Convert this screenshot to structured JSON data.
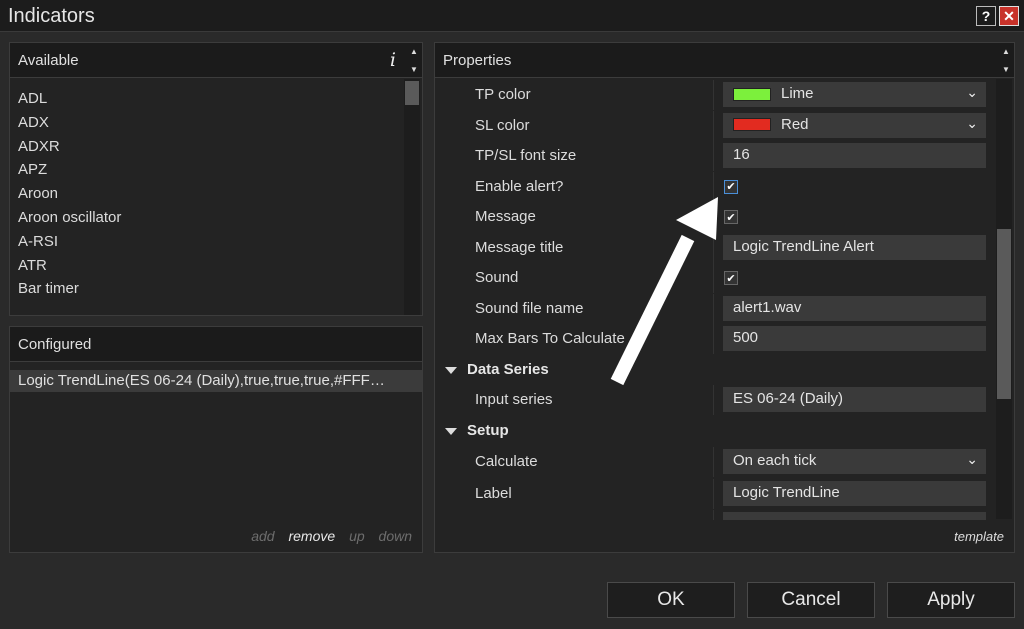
{
  "window": {
    "title": "Indicators",
    "help_label": "?",
    "close_label": "✕"
  },
  "available": {
    "header": "Available",
    "info_label": "i",
    "items": [
      "ADL",
      "ADX",
      "ADXR",
      "APZ",
      "Aroon",
      "Aroon oscillator",
      "A-RSI",
      "ATR",
      "Bar timer"
    ]
  },
  "configured": {
    "header": "Configured",
    "items": [
      "Logic TrendLine(ES 06-24 (Daily),true,true,true,#FFF…"
    ],
    "actions": {
      "add": "add",
      "remove": "remove",
      "up": "up",
      "down": "down"
    }
  },
  "properties": {
    "header": "Properties",
    "rows": {
      "tp_color": {
        "label": "TP color",
        "value": "Lime",
        "swatch": "#7cf03c"
      },
      "sl_color": {
        "label": "SL color",
        "value": "Red",
        "swatch": "#e22b20"
      },
      "font_size": {
        "label": "TP/SL font size",
        "value": "16"
      },
      "enable_alert": {
        "label": "Enable alert?",
        "checked": true
      },
      "message": {
        "label": "Message",
        "checked": true
      },
      "message_title": {
        "label": "Message title",
        "value": "Logic TrendLine Alert"
      },
      "sound": {
        "label": "Sound",
        "checked": true
      },
      "sound_file": {
        "label": "Sound file name",
        "value": "alert1.wav"
      },
      "max_bars": {
        "label": "Max Bars To Calculate",
        "value": "500"
      },
      "data_series_group": {
        "label": "Data Series"
      },
      "input_series": {
        "label": "Input series",
        "value": "ES 06-24 (Daily)"
      },
      "setup_group": {
        "label": "Setup"
      },
      "calculate": {
        "label": "Calculate",
        "value": "On each tick"
      },
      "label": {
        "label": "Label",
        "value": "Logic TrendLine"
      }
    },
    "template_label": "template"
  },
  "buttons": {
    "ok": "OK",
    "cancel": "Cancel",
    "apply": "Apply"
  },
  "colors": {
    "accent": "#4a8fd8",
    "background": "#2a2a2a",
    "panel": "#232323"
  },
  "icons": {
    "info": "info-icon",
    "scroll_up": "triangle-up-icon",
    "scroll_down": "triangle-down-icon",
    "dropdown": "chevron-down-icon",
    "check": "checkmark-icon",
    "collapse": "caret-down-icon"
  }
}
